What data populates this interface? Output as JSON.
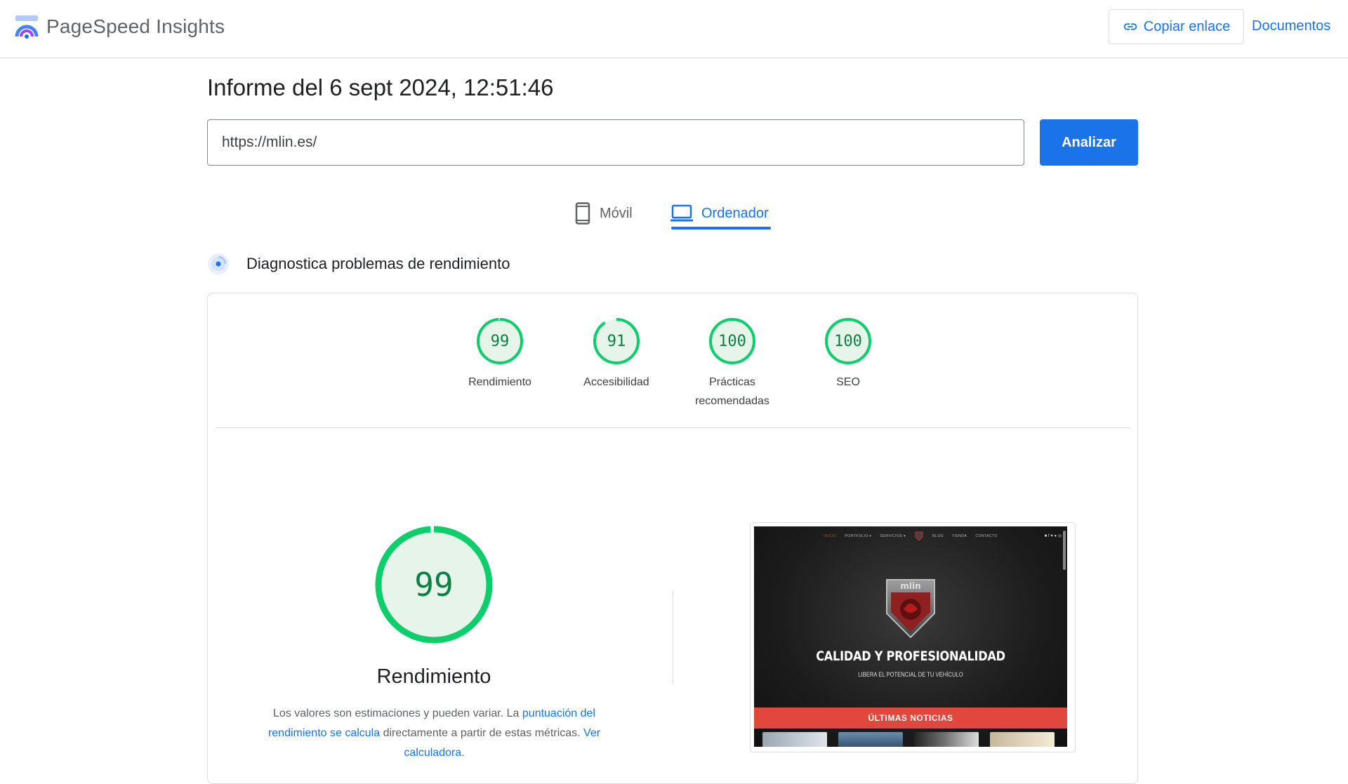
{
  "header": {
    "brand": "PageSpeed Insights",
    "copy_link": "Copiar enlace",
    "docs": "Documentos"
  },
  "report": {
    "title": "Informe del 6 sept 2024, 12:51:46",
    "url": "https://mlin.es/",
    "analyze_label": "Analizar"
  },
  "tabs": [
    {
      "label": "Móvil",
      "icon": "mobile-phone-icon",
      "active": false
    },
    {
      "label": "Ordenador",
      "icon": "laptop-icon",
      "active": true
    }
  ],
  "diagnose": {
    "text": "Diagnostica problemas de rendimiento"
  },
  "scores": [
    {
      "value": "99",
      "label": "Rendimiento",
      "fraction": 0.99
    },
    {
      "value": "91",
      "label": "Accesibilidad",
      "fraction": 0.91
    },
    {
      "value": "100",
      "label": "Prácticas recomendadas",
      "fraction": 1.0
    },
    {
      "value": "100",
      "label": "SEO",
      "fraction": 1.0
    }
  ],
  "performance": {
    "score": "99",
    "fraction": 0.99,
    "title": "Rendimiento",
    "desc_1": "Los valores son estimaciones y pueden variar. La ",
    "link_1": "puntuación del rendimiento se calcula",
    "desc_2": " directamente a partir de estas métricas. ",
    "link_2": "Ver calculadora",
    "desc_3": "."
  },
  "screenshot": {
    "nav_items": [
      "INICIO",
      "PORTFOLIO ▾",
      "SERVICIOS ▾",
      "BLOG",
      "TIENDA",
      "CONTACTO"
    ],
    "headline": "CALIDAD Y PROFESIONALIDAD",
    "subline": "LIBERA EL POTENCIAL DE TU VEHÍCULO",
    "bar": "ÚLTIMAS NOTICIAS",
    "logo_text": "mlin"
  },
  "colors": {
    "accent": "#1a73e8",
    "pass_green": "#0cce6b",
    "pass_text": "#0b8043",
    "pass_bg": "#e6f4ea"
  }
}
